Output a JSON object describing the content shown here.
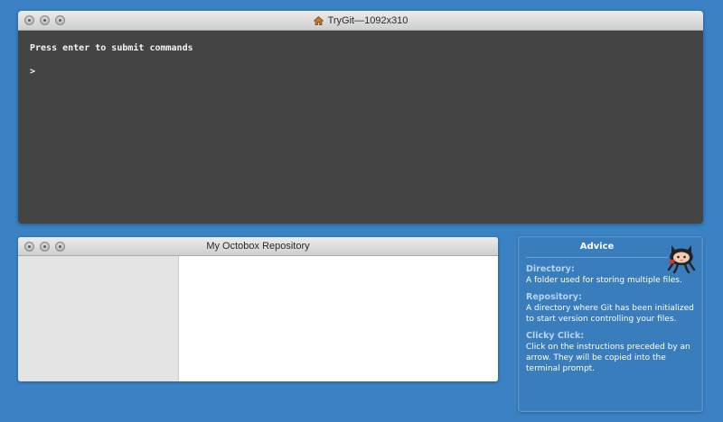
{
  "terminal": {
    "title": "TryGit—1092x310",
    "intro": "Press enter to submit commands",
    "prompt": ">"
  },
  "repository": {
    "title": "My Octobox Repository"
  },
  "advice": {
    "title": "Advice",
    "items": [
      {
        "term": "Directory:",
        "definition": "A folder used for storing multiple files."
      },
      {
        "term": "Repository:",
        "definition": "A directory where Git has been initialized to start version controlling your files."
      },
      {
        "term": "Clicky Click:",
        "definition": "Click on the instructions preceded by an arrow. They will be copied into the terminal prompt."
      }
    ]
  },
  "colors": {
    "background": "#3a82c4",
    "terminal_bg": "#444444",
    "advice_term": "#b6d3ef"
  },
  "icons": {
    "title_icon": "home-icon",
    "mascot": "octocat-icon"
  }
}
